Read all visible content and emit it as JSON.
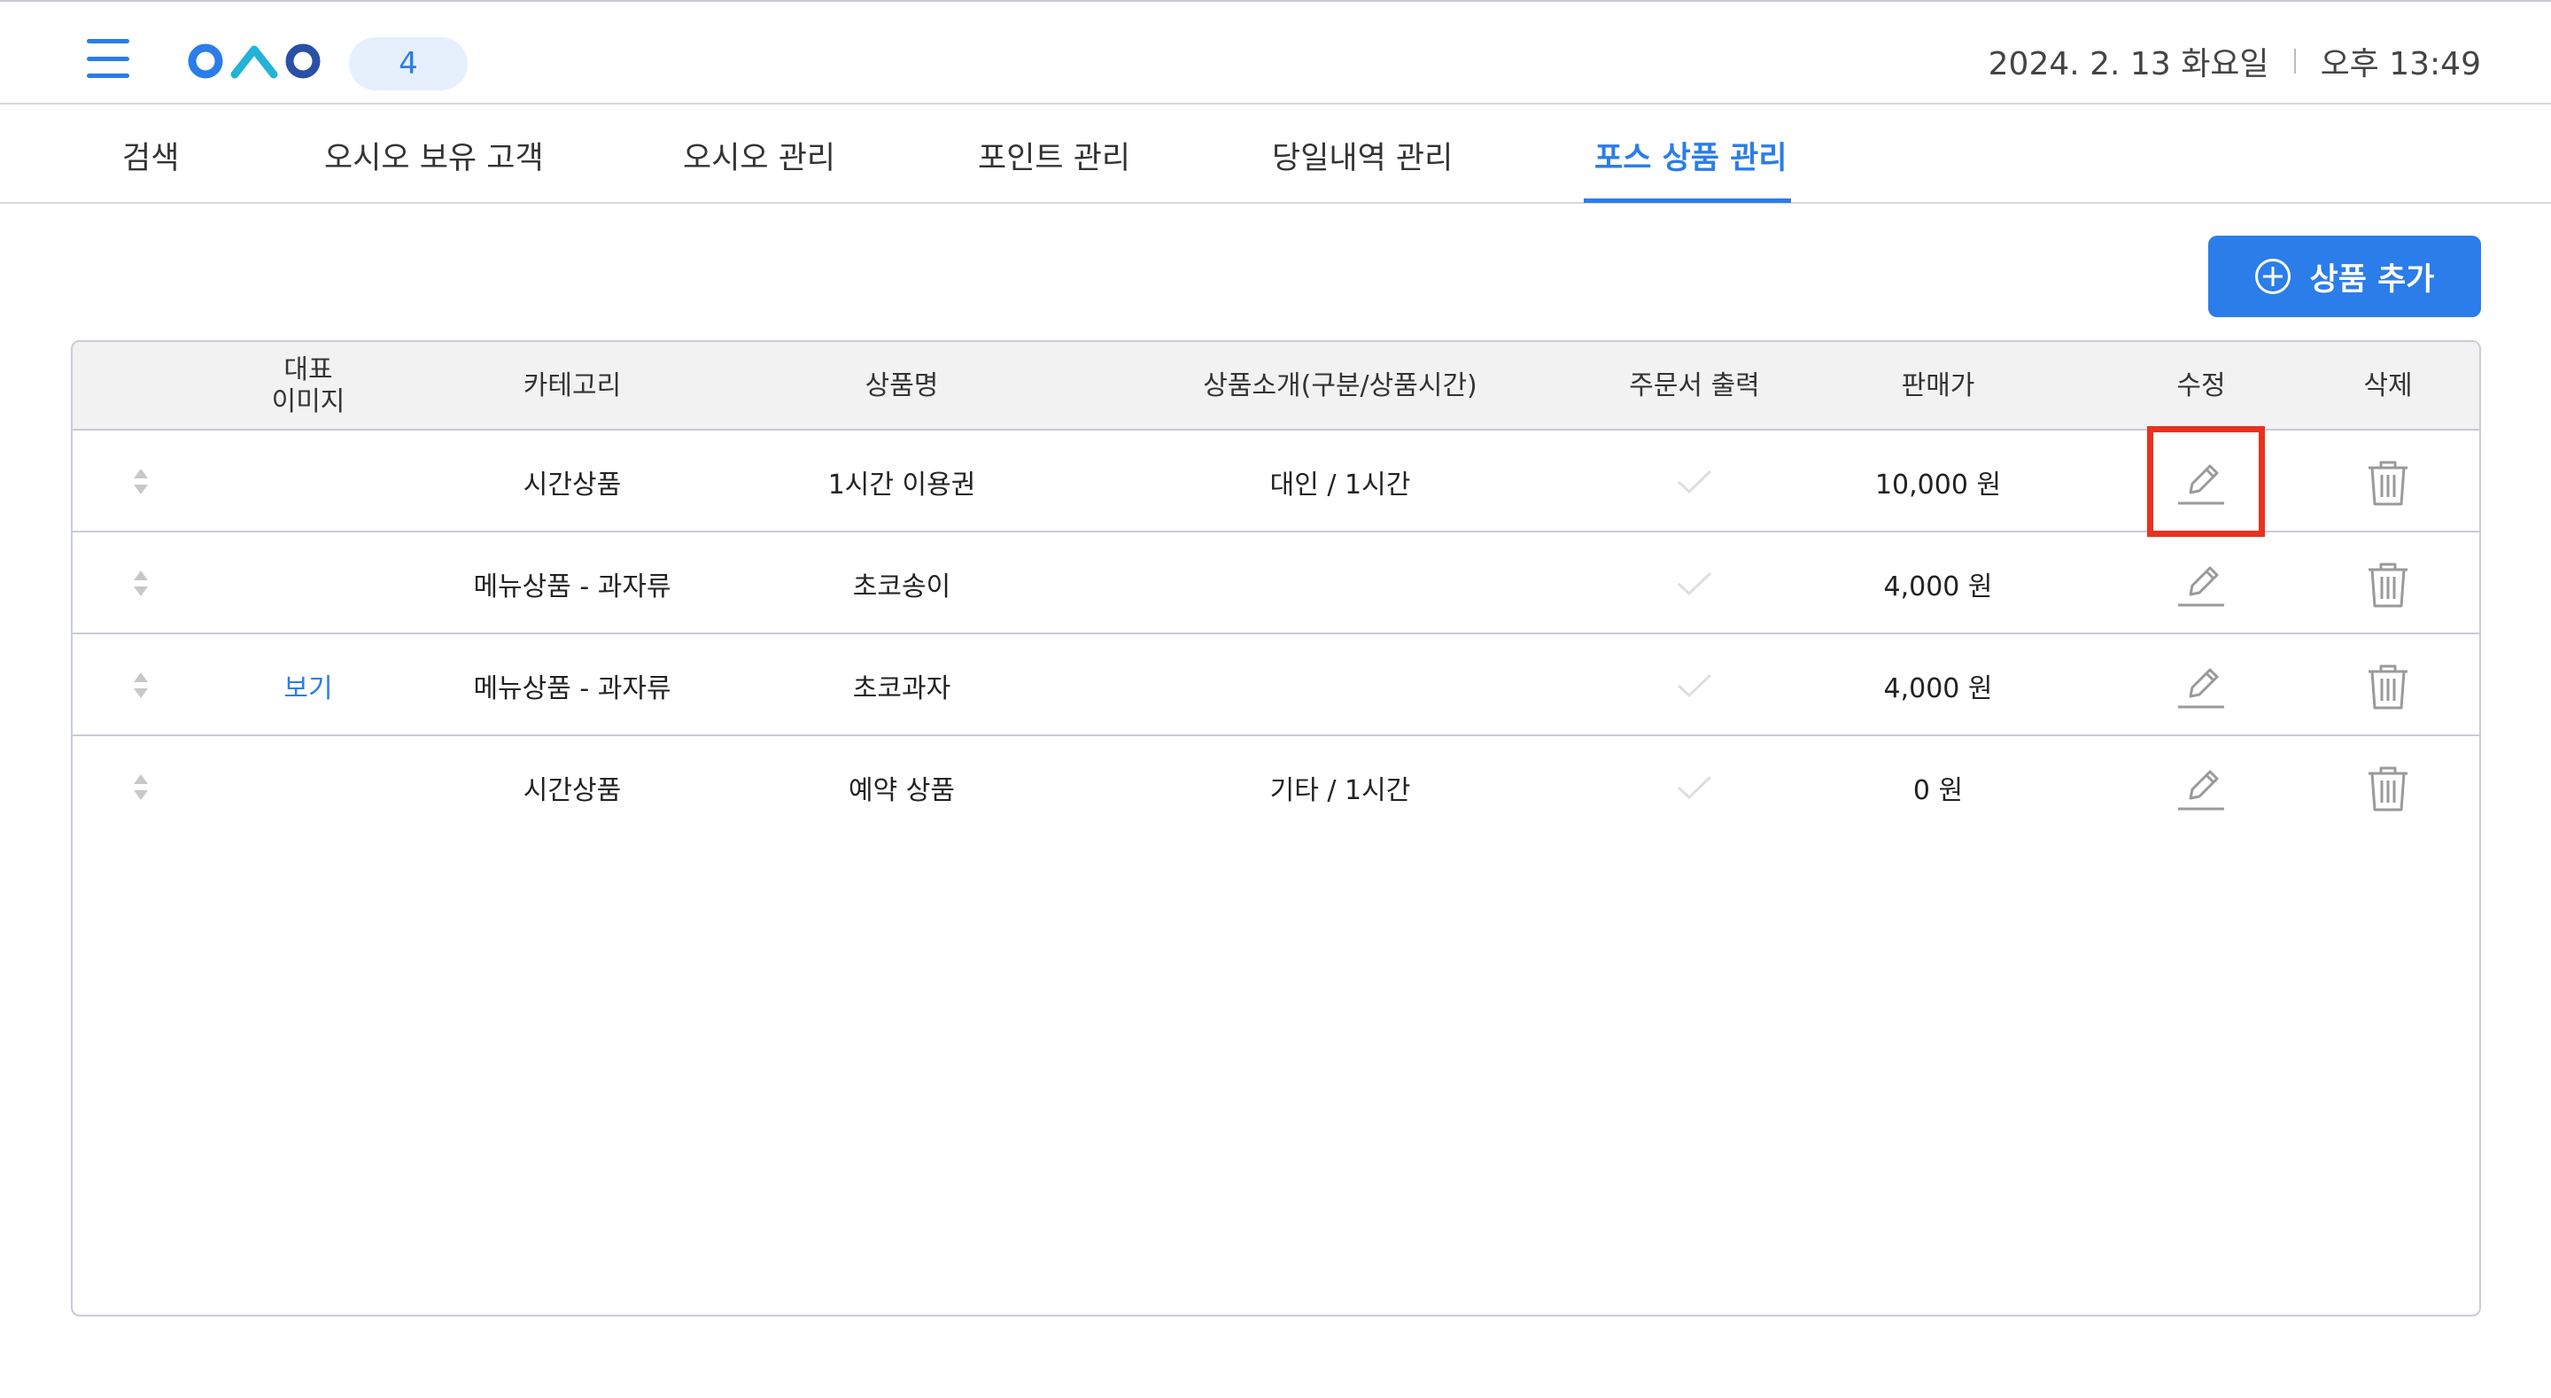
{
  "header": {
    "badge_count": "4",
    "date": "2024. 2. 13 화요일",
    "time": "오후 13:49",
    "logo_name": "oao-logo",
    "accent_color": "#2b7de9"
  },
  "tabs": [
    {
      "label": "검색",
      "active": false
    },
    {
      "label": "오시오 보유 고객",
      "active": false
    },
    {
      "label": "오시오 관리",
      "active": false
    },
    {
      "label": "포인트 관리",
      "active": false
    },
    {
      "label": "당일내역 관리",
      "active": false
    },
    {
      "label": "포스 상품 관리",
      "active": true
    }
  ],
  "toolbar": {
    "add_product_label": "상품 추가"
  },
  "table": {
    "columns": {
      "image_line1": "대표",
      "image_line2": "이미지",
      "category": "카테고리",
      "product_name": "상품명",
      "description": "상품소개(구분/상품시간)",
      "order_print": "주문서 출력",
      "price": "판매가",
      "edit": "수정",
      "delete": "삭제"
    },
    "rows": [
      {
        "image": "",
        "category": "시간상품",
        "product_name": "1시간 이용권",
        "description": "대인 / 1시간",
        "order_print": false,
        "price": "10,000 원"
      },
      {
        "image": "",
        "category": "메뉴상품 - 과자류",
        "product_name": "초코송이",
        "description": "",
        "order_print": false,
        "price": "4,000 원"
      },
      {
        "image": "보기",
        "category": "메뉴상품 - 과자류",
        "product_name": "초코과자",
        "description": "",
        "order_print": false,
        "price": "4,000 원"
      },
      {
        "image": "",
        "category": "시간상품",
        "product_name": "예약 상품",
        "description": "기타 / 1시간",
        "order_print": false,
        "price": "0 원"
      }
    ]
  },
  "annotation": {
    "highlight_color": "#e8321e",
    "highlighted_element": "edit-button row 1"
  }
}
